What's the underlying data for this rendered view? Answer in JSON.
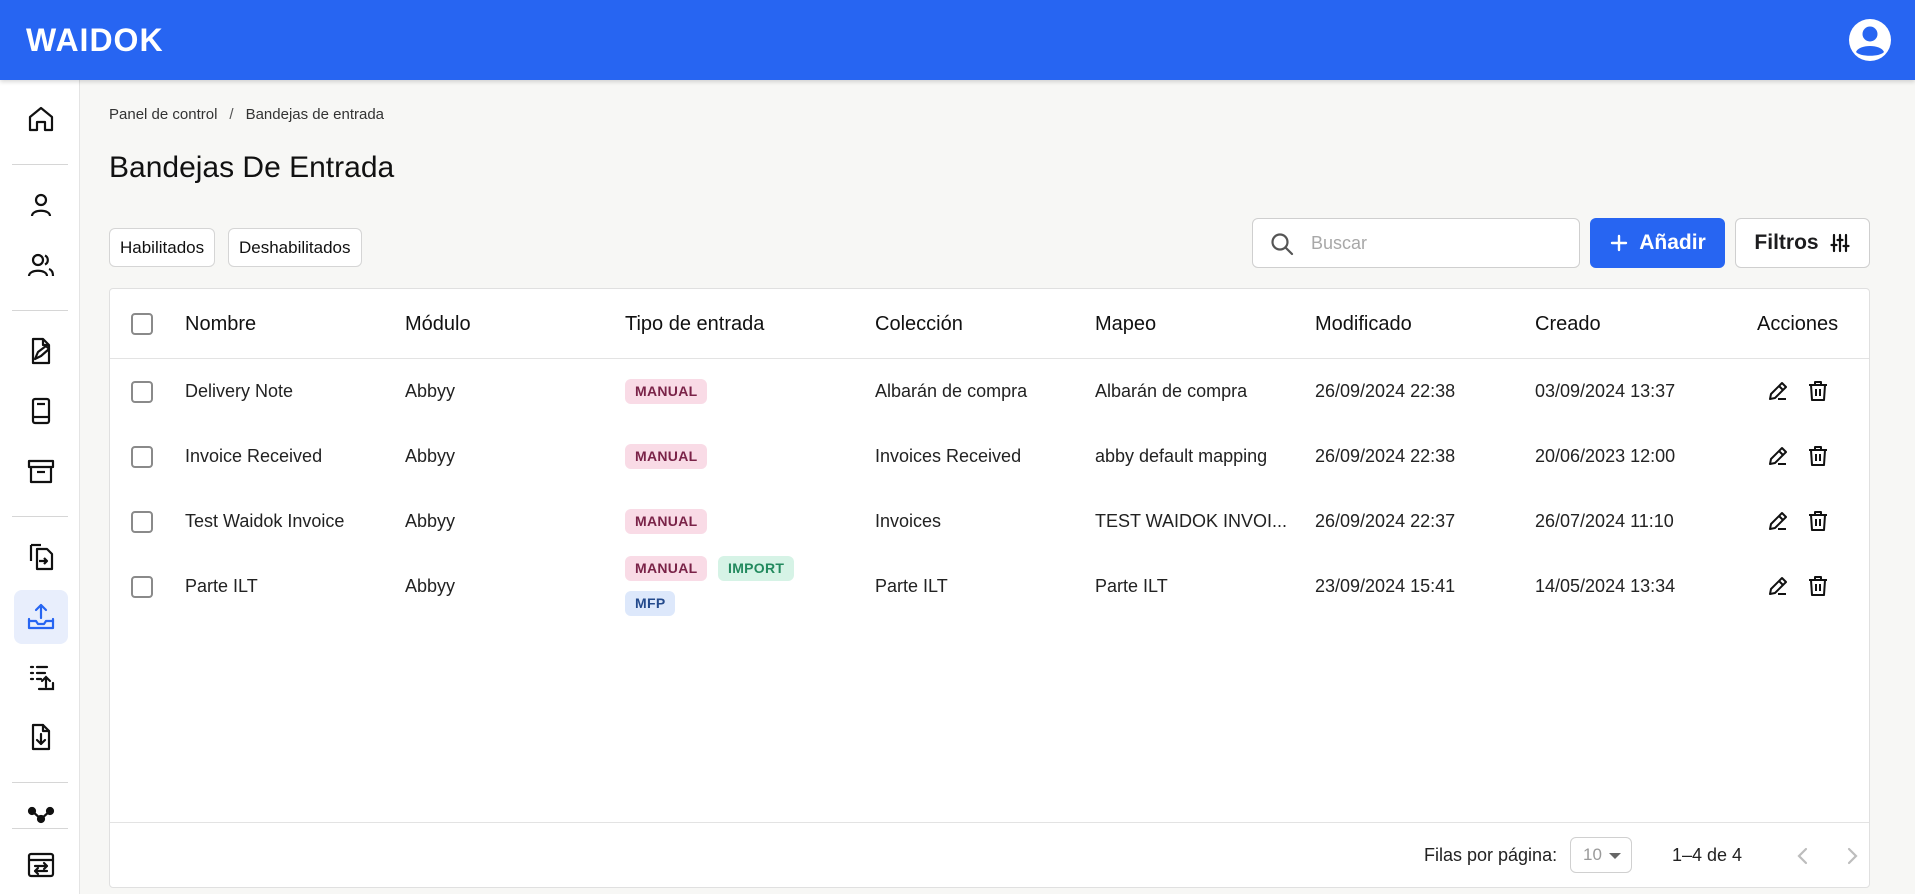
{
  "app": {
    "logo": "WAIDOK"
  },
  "header": {
    "account_icon": "account-circle-icon"
  },
  "sidebar": {
    "items": [
      {
        "name": "home",
        "icon": "home-icon",
        "active": false
      },
      {
        "name": "user",
        "icon": "user-icon",
        "active": false
      },
      {
        "name": "users",
        "icon": "users-icon",
        "active": false
      },
      {
        "name": "document-edit",
        "icon": "document-edit-icon",
        "active": false
      },
      {
        "name": "book",
        "icon": "book-icon",
        "active": false
      },
      {
        "name": "archive",
        "icon": "archive-icon",
        "active": false
      },
      {
        "name": "document-transfer",
        "icon": "document-transfer-icon",
        "active": false
      },
      {
        "name": "inbox-upload",
        "icon": "inbox-upload-icon",
        "active": true
      },
      {
        "name": "list-upload",
        "icon": "list-upload-icon",
        "active": false
      },
      {
        "name": "document-download",
        "icon": "document-download-icon",
        "active": false
      },
      {
        "name": "workflow",
        "icon": "workflow-icon",
        "active": false
      },
      {
        "name": "window-transfer",
        "icon": "window-transfer-icon",
        "active": false
      }
    ]
  },
  "breadcrumb": {
    "items": [
      "Panel de control",
      "Bandejas de entrada"
    ],
    "separator": "/"
  },
  "page": {
    "title": "Bandejas De Entrada"
  },
  "filters": {
    "chips": [
      "Habilitados",
      "Deshabilitados"
    ]
  },
  "search": {
    "placeholder": "Buscar",
    "value": ""
  },
  "toolbar": {
    "add_label": "Añadir",
    "filters_label": "Filtros"
  },
  "table": {
    "columns": [
      "Nombre",
      "Módulo",
      "Tipo de entrada",
      "Colección",
      "Mapeo",
      "Modificado",
      "Creado",
      "Acciones"
    ],
    "rows": [
      {
        "nombre": "Delivery Note",
        "modulo": "Abbyy",
        "tipos": [
          "MANUAL"
        ],
        "coleccion": "Albarán de compra",
        "mapeo": "Albarán de compra",
        "modificado": "26/09/2024 22:38",
        "creado": "03/09/2024 13:37"
      },
      {
        "nombre": "Invoice Received",
        "modulo": "Abbyy",
        "tipos": [
          "MANUAL"
        ],
        "coleccion": "Invoices Received",
        "mapeo": "abby default mapping",
        "modificado": "26/09/2024 22:38",
        "creado": "20/06/2023 12:00"
      },
      {
        "nombre": "Test Waidok Invoice",
        "modulo": "Abbyy",
        "tipos": [
          "MANUAL"
        ],
        "coleccion": "Invoices",
        "mapeo": "TEST WAIDOK INVOI...",
        "modificado": "26/09/2024 22:37",
        "creado": "26/07/2024 11:10"
      },
      {
        "nombre": "Parte ILT",
        "modulo": "Abbyy",
        "tipos": [
          "MANUAL",
          "IMPORT",
          "MFP"
        ],
        "coleccion": "Parte ILT",
        "mapeo": "Parte ILT",
        "modificado": "23/09/2024 15:41",
        "creado": "14/05/2024 13:34"
      }
    ]
  },
  "pagination": {
    "rows_per_page_label": "Filas por página:",
    "rows_per_page": "10",
    "range": "1–4 de 4"
  },
  "colors": {
    "brand": "#2765f2",
    "manual_bg": "#f9dbe6",
    "manual_fg": "#7a2348",
    "import_bg": "#d6f3e6",
    "import_fg": "#228a5e",
    "mfp_bg": "#dde8fb",
    "mfp_fg": "#244a8c"
  }
}
